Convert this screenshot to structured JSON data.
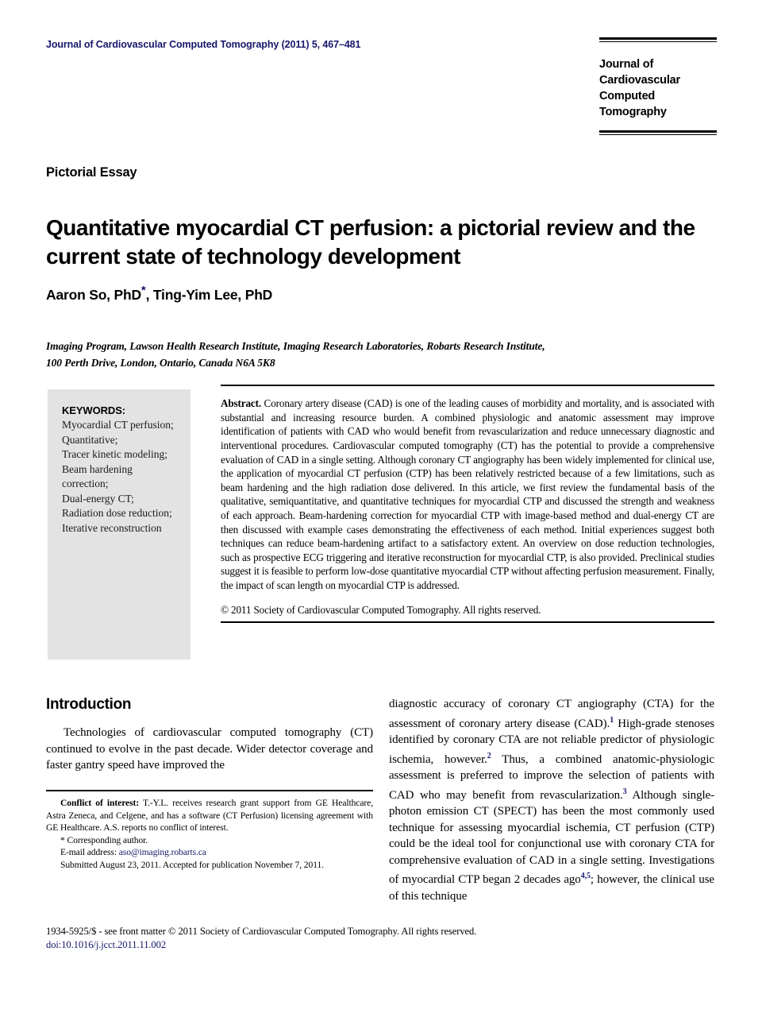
{
  "header": {
    "journal_citation": "Journal of Cardiovascular Computed Tomography (2011) 5, 467–481",
    "logo_line1": "Journal of",
    "logo_line2": "Cardiovascular",
    "logo_line3": "Computed Tomography",
    "accent_color": "#16176b"
  },
  "article": {
    "type": "Pictorial Essay",
    "title": "Quantitative myocardial CT perfusion: a pictorial review and the current state of technology development",
    "authors": "Aaron So, PhD",
    "corresponding_marker": "*",
    "authors_rest": ", Ting-Yim Lee, PhD",
    "affiliation_line1": "Imaging Program, Lawson Health Research Institute, Imaging Research Laboratories, Robarts Research Institute,",
    "affiliation_line2": "100 Perth Drive, London, Ontario, Canada N6A 5K8"
  },
  "keywords": {
    "heading": "KEYWORDS:",
    "items": [
      "Myocardial CT perfusion;",
      "Quantitative;",
      "Tracer kinetic modeling;",
      "Beam hardening correction;",
      "Dual-energy CT;",
      "Radiation dose reduction;",
      "Iterative reconstruction"
    ]
  },
  "abstract": {
    "label": "Abstract.",
    "body": "Coronary artery disease (CAD) is one of the leading causes of morbidity and mortality, and is associated with substantial and increasing resource burden. A combined physiologic and anatomic assessment may improve identification of patients with CAD who would benefit from revascularization and reduce unnecessary diagnostic and interventional procedures. Cardiovascular computed tomography (CT) has the potential to provide a comprehensive evaluation of CAD in a single setting. Although coronary CT angiography has been widely implemented for clinical use, the application of myocardial CT perfusion (CTP) has been relatively restricted because of a few limitations, such as beam hardening and the high radiation dose delivered. In this article, we first review the fundamental basis of the qualitative, semiquantitative, and quantitative techniques for myocardial CTP and discussed the strength and weakness of each approach. Beam-hardening correction for myocardial CTP with image-based method and dual-energy CT are then discussed with example cases demonstrating the effectiveness of each method. Initial experiences suggest both techniques can reduce beam-hardening artifact to a satisfactory extent. An overview on dose reduction technologies, such as prospective ECG triggering and iterative reconstruction for myocardial CTP, is also provided. Preclinical studies suggest it is feasible to perform low-dose quantitative myocardial CTP without affecting perfusion measurement. Finally, the impact of scan length on myocardial CTP is addressed.",
    "copyright": "© 2011 Society of Cardiovascular Computed Tomography. All rights reserved."
  },
  "introduction": {
    "heading": "Introduction",
    "paragraph_left": "Technologies of cardiovascular computed tomography (CT) continued to evolve in the past decade. Wider detector coverage and faster gantry speed have improved the",
    "paragraph_right_part1": "diagnostic accuracy of coronary CT angiography (CTA) for the assessment of coronary artery disease (CAD).",
    "ref1": "1",
    "paragraph_right_part2": " High-grade stenoses identified by coronary CTA are not reliable predictor of physiologic ischemia, however.",
    "ref2": "2",
    "paragraph_right_part3": " Thus, a combined anatomic-physiologic assessment is preferred to improve the selection of patients with CAD who may benefit from revascularization.",
    "ref3": "3",
    "paragraph_right_part4": " Although single-photon emission CT (SPECT) has been the most commonly used technique for assessing myocardial ischemia, CT perfusion (CTP) could be the ideal tool for conjunctional use with coronary CTA for comprehensive evaluation of CAD in a single setting. Investigations of myocardial CTP began 2 decades ago",
    "ref45": "4,5",
    "paragraph_right_part5": "; however, the clinical use of this technique"
  },
  "footnotes": {
    "conflict_label": "Conflict of interest:",
    "conflict_text": " T.-Y.L. receives research grant support from GE Healthcare, Astra Zeneca, and Celgene, and has a software (CT Perfusion) licensing agreement with GE Healthcare. A.S. reports no conflict of interest.",
    "corresponding": "* Corresponding author.",
    "email_label": "E-mail address:",
    "email": "aso@imaging.robarts.ca",
    "submitted": "Submitted August 23, 2011. Accepted for publication November 7, 2011."
  },
  "footer": {
    "issn_line": "1934-5925/$ - see front matter © 2011 Society of Cardiovascular Computed Tomography. All rights reserved.",
    "doi": "doi:10.1016/j.jcct.2011.11.002"
  }
}
